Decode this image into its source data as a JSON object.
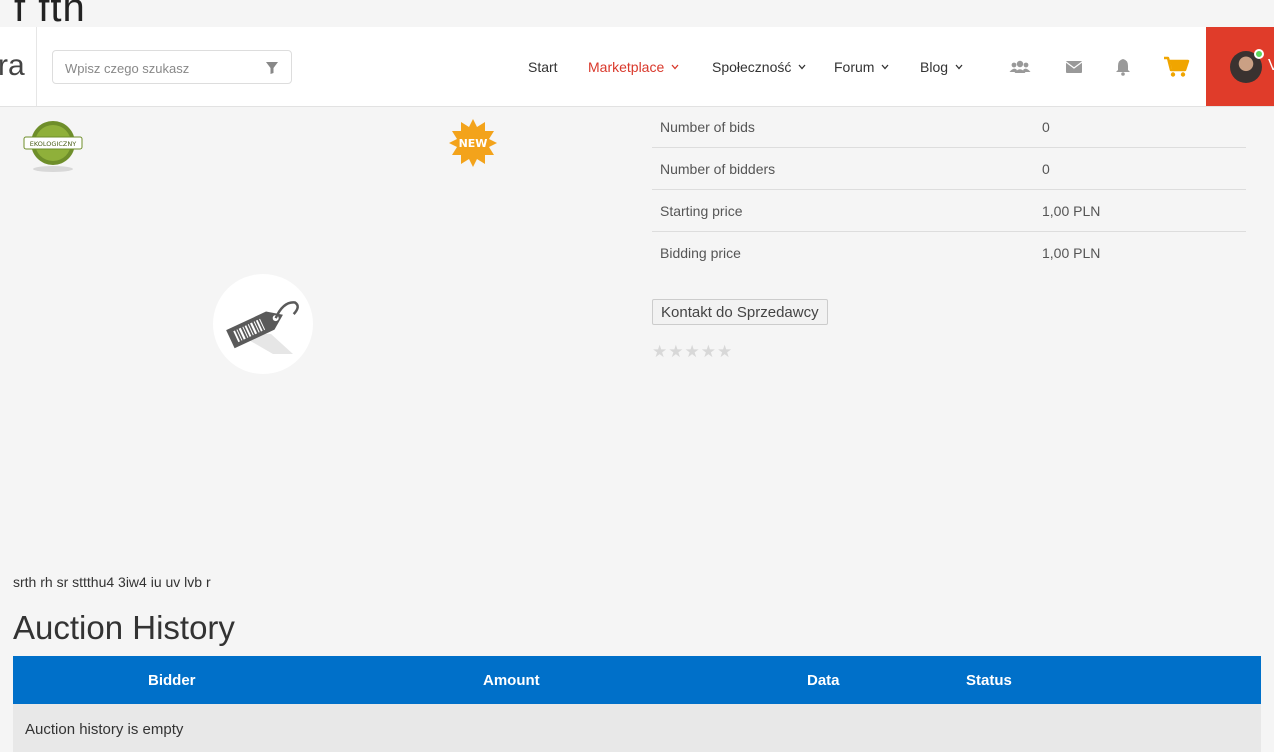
{
  "page": {
    "behind_title": "f fth"
  },
  "header": {
    "logo_fragment": "ra",
    "search": {
      "placeholder": "Wpisz czego szukasz"
    },
    "nav": {
      "start": "Start",
      "marketplace": "Marketplace",
      "spolecznosc": "Społeczność",
      "forum": "Forum",
      "blog": "Blog"
    },
    "icons": [
      "users-icon",
      "envelope-icon",
      "bell-icon",
      "cart-icon"
    ],
    "accent_color": "#d9382b",
    "cart_color": "#f0a500",
    "user_letter": "V"
  },
  "product": {
    "eco_badge": "EKOLOGICZNY",
    "new_badge": "NEW",
    "details": [
      {
        "label": "Number of bids",
        "value": "0"
      },
      {
        "label": "Number of bidders",
        "value": "0"
      },
      {
        "label": "Starting price",
        "value": "1,00 PLN"
      },
      {
        "label": "Bidding price",
        "value": "1,00 PLN"
      }
    ],
    "contact_button": "Kontakt do Sprzedawcy",
    "rating_stars": 0,
    "description": "srth rh sr sttthu4 3iw4 iu uv lvb r"
  },
  "history": {
    "title": "Auction History",
    "columns": [
      "Bidder",
      "Amount",
      "Data",
      "Status"
    ],
    "empty_message": "Auction history is empty",
    "header_color": "#0070c9"
  }
}
